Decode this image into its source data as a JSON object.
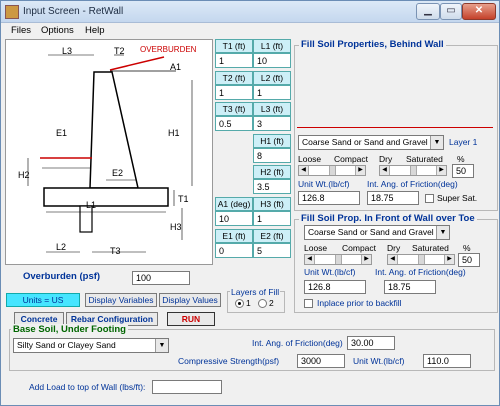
{
  "window": {
    "title": "Input Screen - RetWall"
  },
  "menu": {
    "files": "Files",
    "options": "Options",
    "help": "Help"
  },
  "diagram": {
    "labels": {
      "l3": "L3",
      "t2": "T2",
      "overburden": "OVERBURDEN",
      "a1": "A1",
      "e1": "E1",
      "h1": "H1",
      "h2": "H2",
      "e2": "E2",
      "l1": "L1",
      "t1": "T1",
      "h3": "H3",
      "l2": "L2",
      "t3": "T3"
    }
  },
  "dims": {
    "headers": [
      "T1 (ft)",
      "L1 (ft)",
      "T2 (ft)",
      "L2 (ft)",
      "T3 (ft)",
      "L3 (ft)",
      "H1 (ft)",
      "H2 (ft)",
      "A1 (deg)",
      "H3 (ft)",
      "E1 (ft)",
      "E2 (ft)"
    ],
    "values": {
      "t1": "1",
      "l1": "10",
      "t2": "1",
      "l2": "1",
      "t3": "0.5",
      "l3": "3",
      "h1": "8",
      "h2": "3.5",
      "a1": "10",
      "h3": "1",
      "e1": "0",
      "e2": "5"
    }
  },
  "fill_behind": {
    "title": "Fill Soil Properties, Behind Wall",
    "soil": "Coarse Sand or Sand and Gravel",
    "layer": "Layer 1",
    "density_labels": [
      "Loose",
      "Compact",
      "Dry",
      "Saturated"
    ],
    "percent_label": "%",
    "percent": "50",
    "unit_wt_label": "Unit Wt.(lb/cf)",
    "unit_wt": "126.8",
    "friction_label": "Int. Ang. of Friction(deg)",
    "friction": "18.75",
    "super_sat": "Super Sat."
  },
  "fill_front": {
    "title": "Fill Soil Prop. In Front of Wall over Toe",
    "soil": "Coarse Sand or Sand and Gravel",
    "density_labels": [
      "Loose",
      "Compact",
      "Dry",
      "Saturated"
    ],
    "percent_label": "%",
    "percent": "50",
    "unit_wt_label": "Unit Wt.(lb/cf)",
    "unit_wt": "126.8",
    "friction_label": "Int. Ang. of Friction(deg)",
    "friction": "18.75",
    "inplace": "Inplace prior to backfill"
  },
  "overburden": {
    "label": "Overburden (psf)",
    "value": "100"
  },
  "units": {
    "label": "Units = US"
  },
  "buttons": {
    "display_vars": "Display Variables",
    "display_vals": "Display Values",
    "concrete": "Concrete",
    "rebar": "Rebar Configuration",
    "run": "RUN"
  },
  "layers": {
    "title": "Layers of Fill",
    "opt1": "1",
    "opt2": "2"
  },
  "base_soil": {
    "title": "Base Soil, Under Footing",
    "soil": "Silty Sand or Clayey Sand",
    "friction_label": "Int. Ang. of Friction(deg)",
    "friction": "30.00",
    "strength_label": "Compressive Strength(psf)",
    "strength": "3000",
    "unit_wt_label": "Unit Wt.(lb/cf)",
    "unit_wt": "110.0"
  },
  "add_load": {
    "label": "Add Load to top of Wall (lbs/ft):",
    "value": ""
  },
  "colors": {
    "units_bg": "#46e5ff",
    "header_cells": "#cdeff7",
    "run_text": "#cc0000",
    "title_blue": "#003399",
    "overburden_line": "#cc0000"
  }
}
